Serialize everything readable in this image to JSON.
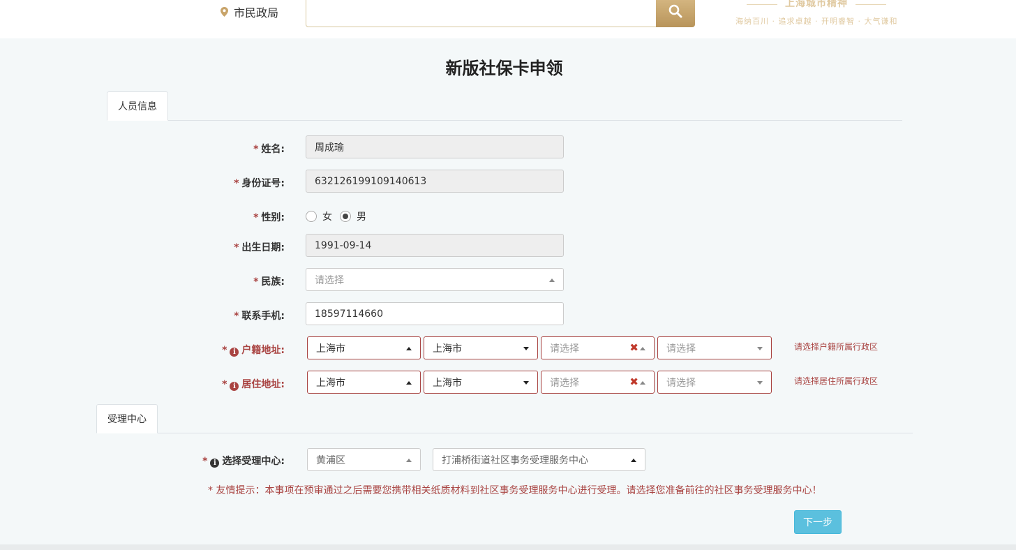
{
  "header": {
    "location": "市民政局",
    "search_value": "",
    "slogan_title": "上海城市精神",
    "slogan_sub": "海纳百川 · 追求卓越 · 开明睿智 · 大气谦和"
  },
  "page": {
    "title": "新版社保卡申领"
  },
  "tabs": {
    "person": "人员信息",
    "center": "受理中心"
  },
  "form": {
    "name": {
      "label": "姓名:",
      "value": "周成瑜"
    },
    "id_number": {
      "label": "身份证号:",
      "value": "632126199109140613"
    },
    "gender": {
      "label": "性别:",
      "options": [
        "女",
        "男"
      ],
      "selected": "男"
    },
    "birth": {
      "label": "出生日期:",
      "value": "1991-09-14"
    },
    "ethnicity": {
      "label": "民族:",
      "placeholder": "请选择"
    },
    "phone": {
      "label": "联系手机:",
      "value": "18597114660"
    },
    "huji": {
      "label": "户籍地址:",
      "province": "上海市",
      "city": "上海市",
      "district": "请选择",
      "street": "请选择",
      "error": "请选择户籍所属行政区"
    },
    "residence": {
      "label": "居住地址:",
      "province": "上海市",
      "city": "上海市",
      "district": "请选择",
      "street": "请选择",
      "error": "请选择居住所属行政区"
    },
    "center": {
      "label": "选择受理中心:",
      "district": "黄浦区",
      "center": "打浦桥街道社区事务受理服务中心"
    },
    "required_mark": "*"
  },
  "tip": "* 友情提示：本事项在预审通过之后需要您携带相关纸质材料到社区事务受理服务中心进行受理。请选择您准备前往的社区事务受理服务中心！",
  "buttons": {
    "next": "下一步"
  },
  "colors": {
    "error": "#a94442",
    "gold": "#c8a46a",
    "primary": "#5bc0de"
  }
}
